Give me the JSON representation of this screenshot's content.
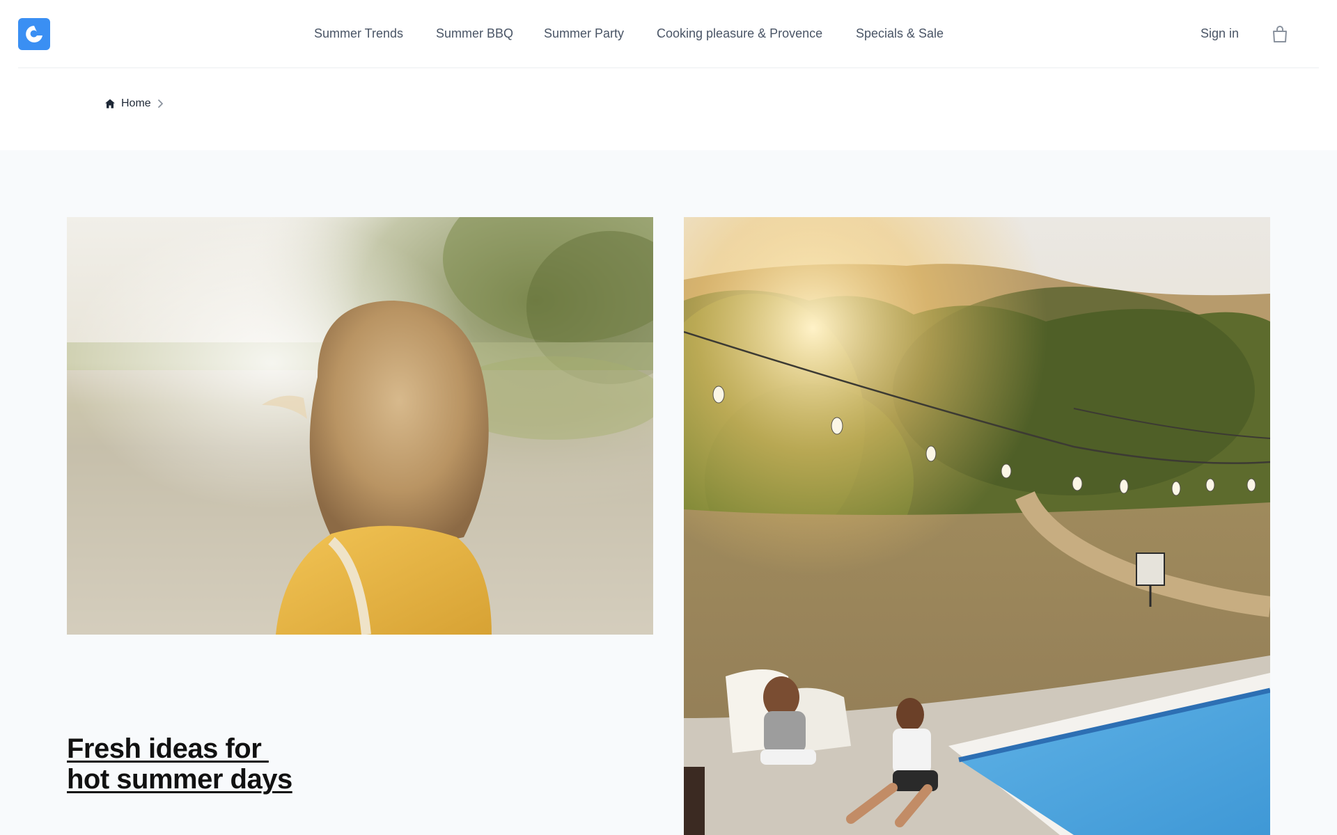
{
  "header": {
    "logo_icon": "shop-logo-icon",
    "nav": [
      {
        "label": "Summer Trends"
      },
      {
        "label": "Summer BBQ"
      },
      {
        "label": "Summer Party"
      },
      {
        "label": "Cooking pleasure & Provence"
      },
      {
        "label": "Specials & Sale"
      }
    ],
    "sign_in": "Sign in",
    "cart_icon": "shopping-bag-icon",
    "accent_color": "#3a8ff3"
  },
  "breadcrumb": {
    "home_icon": "home-icon",
    "home_label": "Home",
    "separator_icon": "chevron-right-icon"
  },
  "hero": {
    "headline_line1": "Fresh ideas for ",
    "headline_line2": "hot summer days",
    "left_image": "woman-with-blonde-hair-in-yellow-shirt-photo",
    "right_image": "pool-party-with-string-lights-photo"
  }
}
